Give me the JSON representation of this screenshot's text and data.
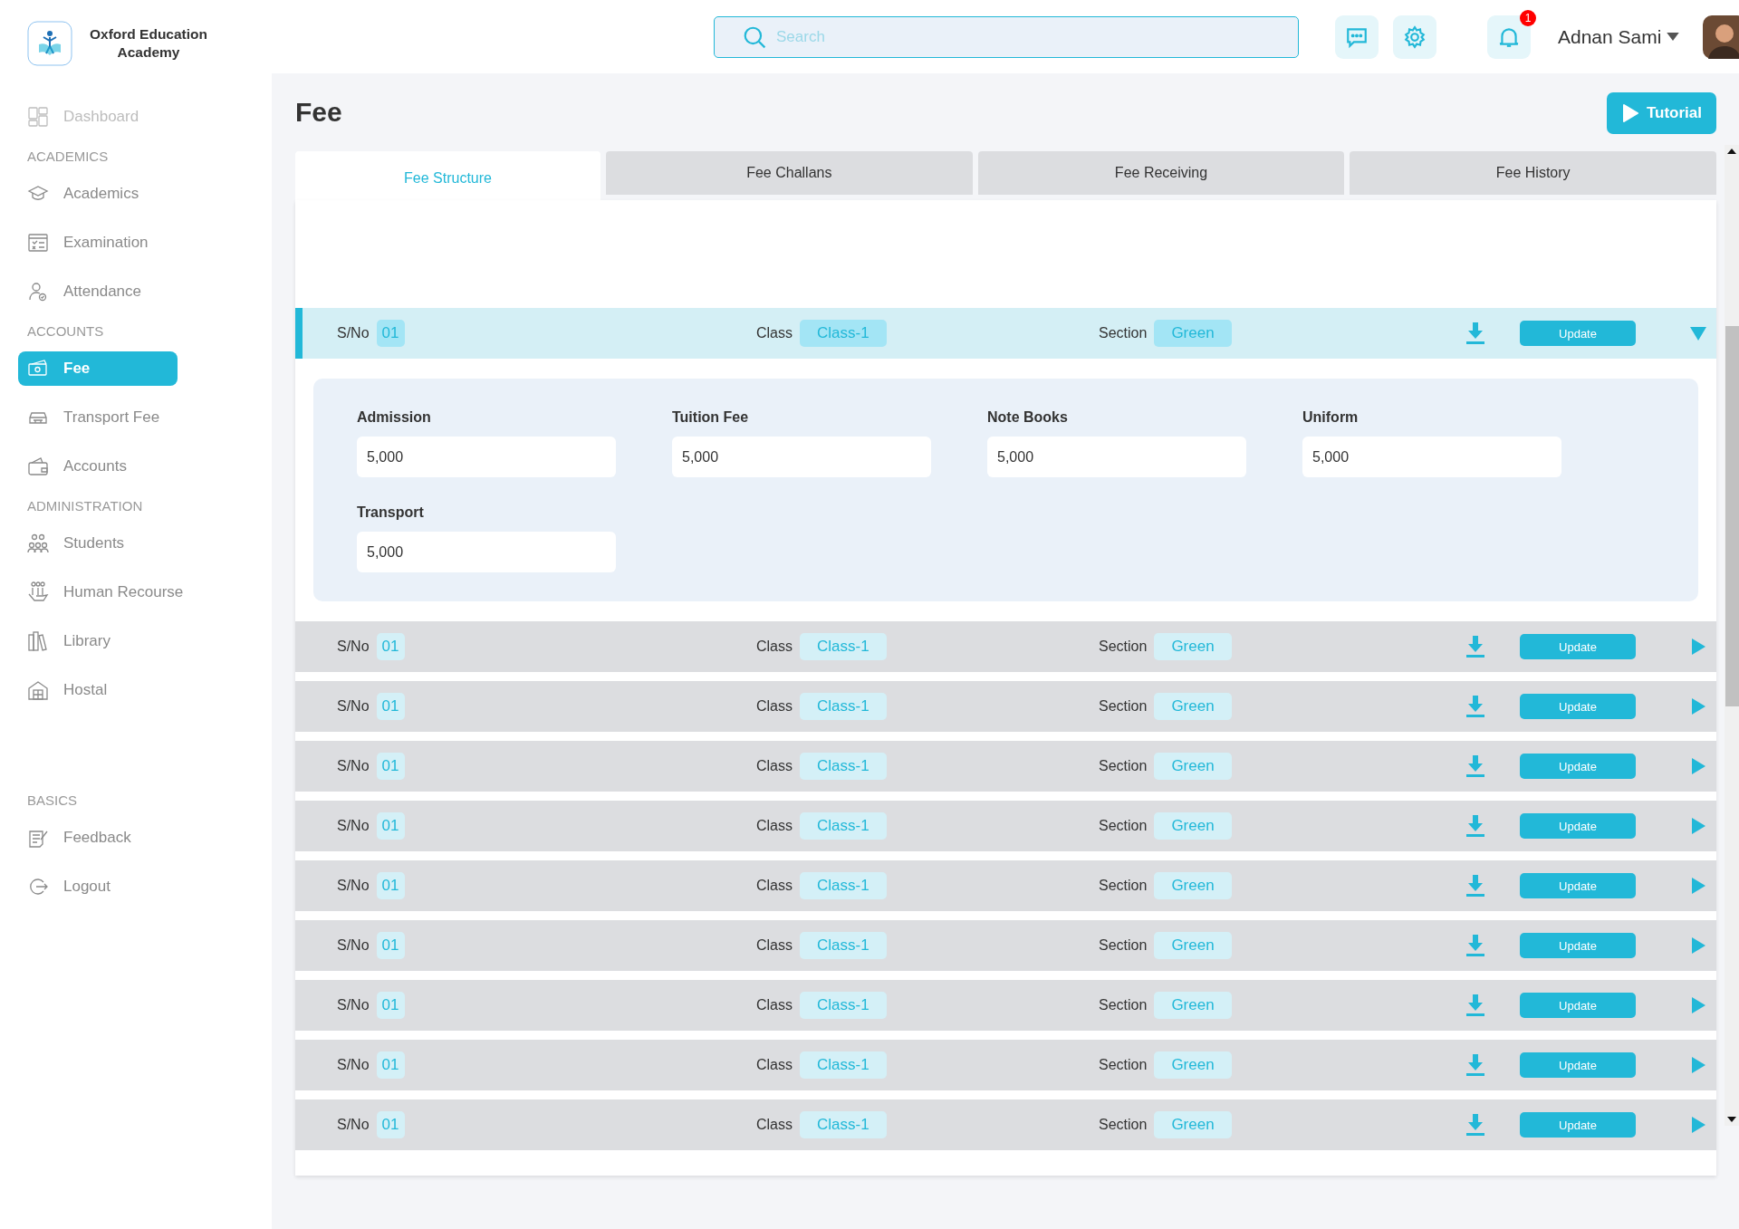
{
  "brand": {
    "name": "Oxford Education Academy"
  },
  "sidebar": {
    "items": [
      {
        "kind": "item",
        "label": "Dashboard",
        "selected": false,
        "disabled": true
      },
      {
        "kind": "section",
        "label": "ACADEMICS"
      },
      {
        "kind": "item",
        "label": "Academics",
        "selected": false,
        "disabled": false
      },
      {
        "kind": "item",
        "label": "Examination",
        "selected": false,
        "disabled": false
      },
      {
        "kind": "item",
        "label": "Attendance",
        "selected": false,
        "disabled": false
      },
      {
        "kind": "section",
        "label": "ACCOUNTS"
      },
      {
        "kind": "item",
        "label": "Fee",
        "selected": true,
        "disabled": false
      },
      {
        "kind": "item",
        "label": "Transport Fee",
        "selected": false,
        "disabled": false
      },
      {
        "kind": "item",
        "label": "Accounts",
        "selected": false,
        "disabled": false
      },
      {
        "kind": "section",
        "label": "ADMINISTRATION"
      },
      {
        "kind": "item",
        "label": "Students",
        "selected": false,
        "disabled": false
      },
      {
        "kind": "item",
        "label": "Human Recourse",
        "selected": false,
        "disabled": false
      },
      {
        "kind": "item",
        "label": "Library",
        "selected": false,
        "disabled": false
      },
      {
        "kind": "item",
        "label": "Hostal",
        "selected": false,
        "disabled": false
      },
      {
        "kind": "spacer"
      },
      {
        "kind": "section",
        "label": "BASICS"
      },
      {
        "kind": "item",
        "label": "Feedback",
        "selected": false,
        "disabled": false
      },
      {
        "kind": "item",
        "label": "Logout",
        "selected": false,
        "disabled": false
      }
    ]
  },
  "header": {
    "search": {
      "placeholder": "Search"
    },
    "notification_count": "1",
    "user": {
      "name": "Adnan Sami"
    }
  },
  "page": {
    "title": "Fee",
    "tutorial_button": "Tutorial"
  },
  "tabs": [
    {
      "label": "Fee Structure",
      "selected": true
    },
    {
      "label": "Fee Challans",
      "selected": false
    },
    {
      "label": "Fee Receiving",
      "selected": false
    },
    {
      "label": "Fee History",
      "selected": false
    }
  ],
  "rows": [
    {
      "sn_label": "S/No",
      "sn": "01",
      "class_label": "Class",
      "class": "Class-1",
      "section_label": "Section",
      "section": "Green",
      "button": "Update",
      "expanded": true,
      "fields": [
        {
          "label": "Admission",
          "value": "5,000"
        },
        {
          "label": "Tuition Fee",
          "value": "5,000"
        },
        {
          "label": "Note Books",
          "value": "5,000"
        },
        {
          "label": "Uniform",
          "value": "5,000"
        },
        {
          "label": "Transport",
          "value": "5,000"
        }
      ]
    },
    {
      "sn_label": "S/No",
      "sn": "01",
      "class_label": "Class",
      "class": "Class-1",
      "section_label": "Section",
      "section": "Green",
      "button": "Update",
      "expanded": false
    },
    {
      "sn_label": "S/No",
      "sn": "01",
      "class_label": "Class",
      "class": "Class-1",
      "section_label": "Section",
      "section": "Green",
      "button": "Update",
      "expanded": false
    },
    {
      "sn_label": "S/No",
      "sn": "01",
      "class_label": "Class",
      "class": "Class-1",
      "section_label": "Section",
      "section": "Green",
      "button": "Update",
      "expanded": false
    },
    {
      "sn_label": "S/No",
      "sn": "01",
      "class_label": "Class",
      "class": "Class-1",
      "section_label": "Section",
      "section": "Green",
      "button": "Update",
      "expanded": false
    },
    {
      "sn_label": "S/No",
      "sn": "01",
      "class_label": "Class",
      "class": "Class-1",
      "section_label": "Section",
      "section": "Green",
      "button": "Update",
      "expanded": false
    },
    {
      "sn_label": "S/No",
      "sn": "01",
      "class_label": "Class",
      "class": "Class-1",
      "section_label": "Section",
      "section": "Green",
      "button": "Update",
      "expanded": false
    },
    {
      "sn_label": "S/No",
      "sn": "01",
      "class_label": "Class",
      "class": "Class-1",
      "section_label": "Section",
      "section": "Green",
      "button": "Update",
      "expanded": false
    },
    {
      "sn_label": "S/No",
      "sn": "01",
      "class_label": "Class",
      "class": "Class-1",
      "section_label": "Section",
      "section": "Green",
      "button": "Update",
      "expanded": false
    },
    {
      "sn_label": "S/No",
      "sn": "01",
      "class_label": "Class",
      "class": "Class-1",
      "section_label": "Section",
      "section": "Green",
      "button": "Update",
      "expanded": false
    }
  ]
}
